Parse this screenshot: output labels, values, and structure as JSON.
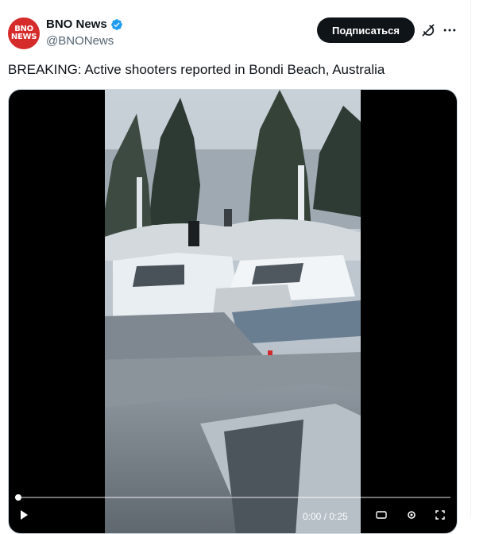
{
  "author": {
    "display_name": "BNO News",
    "handle": "@BNONews",
    "avatar_line1": "BNO",
    "avatar_line2": "NEWS",
    "avatar_color": "#d52b2b",
    "verified": true
  },
  "actions": {
    "subscribe_label": "Подписаться",
    "grok_icon": "grok-icon",
    "more_icon": "more-icon"
  },
  "tweet": {
    "text": "BREAKING: Active shooters reported in Bondi Beach, Australia"
  },
  "video": {
    "progress": 0.01,
    "timecode": "0:00 / 0:25",
    "icons": [
      "play-icon",
      "subtitles-icon",
      "settings-icon",
      "fullscreen-icon"
    ]
  },
  "colors": {
    "button_bg": "#0f1419",
    "verified_blue": "#1d9bf0",
    "secondary_text": "#536471"
  }
}
